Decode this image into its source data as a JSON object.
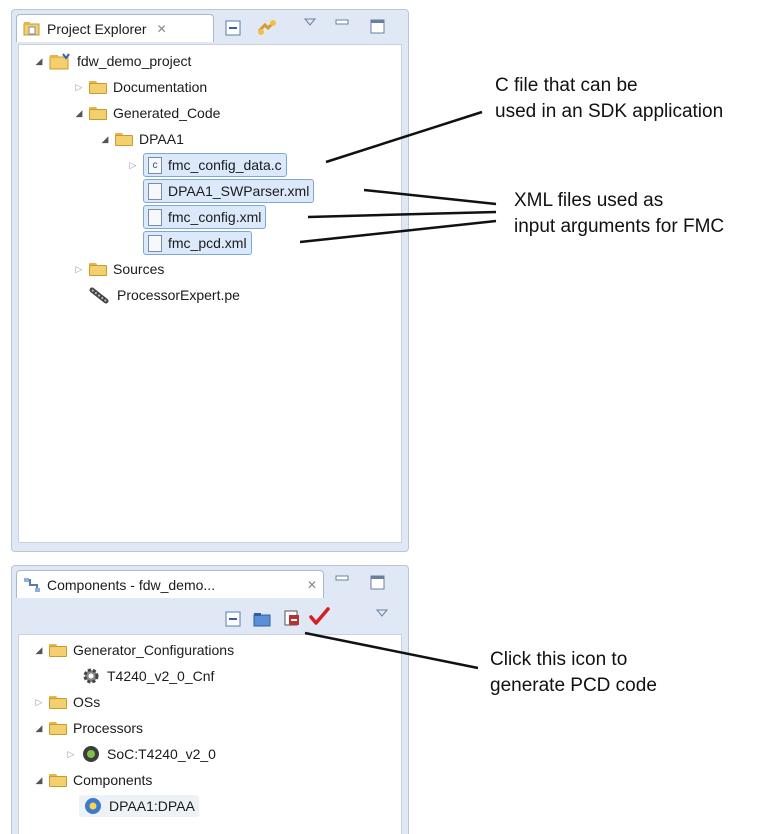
{
  "project_explorer": {
    "tab_label": "Project Explorer",
    "close_glyph": "✕",
    "tree": [
      {
        "label": "fdw_demo_project",
        "icon": "project-folder-icon"
      },
      {
        "label": "Documentation",
        "icon": "folder-icon"
      },
      {
        "label": "Generated_Code",
        "icon": "folder-icon"
      },
      {
        "label": "DPAA1",
        "icon": "folder-icon"
      },
      {
        "label": "fmc_config_data.c",
        "icon": "c-file-icon"
      },
      {
        "label": "DPAA1_SWParser.xml",
        "icon": "xml-file-icon"
      },
      {
        "label": "fmc_config.xml",
        "icon": "xml-file-icon"
      },
      {
        "label": "fmc_pcd.xml",
        "icon": "xml-file-icon"
      },
      {
        "label": "Sources",
        "icon": "folder-icon"
      },
      {
        "label": "ProcessorExpert.pe",
        "icon": "pe-file-icon"
      }
    ]
  },
  "components": {
    "tab_label": "Components - fdw_demo...",
    "close_glyph": "✕",
    "tree": [
      {
        "label": "Generator_Configurations",
        "icon": "folder-icon"
      },
      {
        "label": "T4240_v2_0_Cnf",
        "icon": "config-gear-icon"
      },
      {
        "label": "OSs",
        "icon": "folder-icon"
      },
      {
        "label": "Processors",
        "icon": "folder-icon"
      },
      {
        "label": "SoC:T4240_v2_0",
        "icon": "processor-chip-icon"
      },
      {
        "label": "Components",
        "icon": "folder-icon"
      },
      {
        "label": "DPAA1:DPAA",
        "icon": "component-icon"
      }
    ]
  },
  "annotations": {
    "c_file": [
      "C file that can be",
      "used in an SDK application"
    ],
    "xml_files": [
      "XML files used as",
      "input arguments for FMC"
    ],
    "click_icon": [
      "Click this icon to",
      "generate PCD code"
    ]
  },
  "colors": {
    "selection_bg": "#dbe9fb",
    "selection_border": "#7fa6d8",
    "generate_check": "#d42020"
  }
}
